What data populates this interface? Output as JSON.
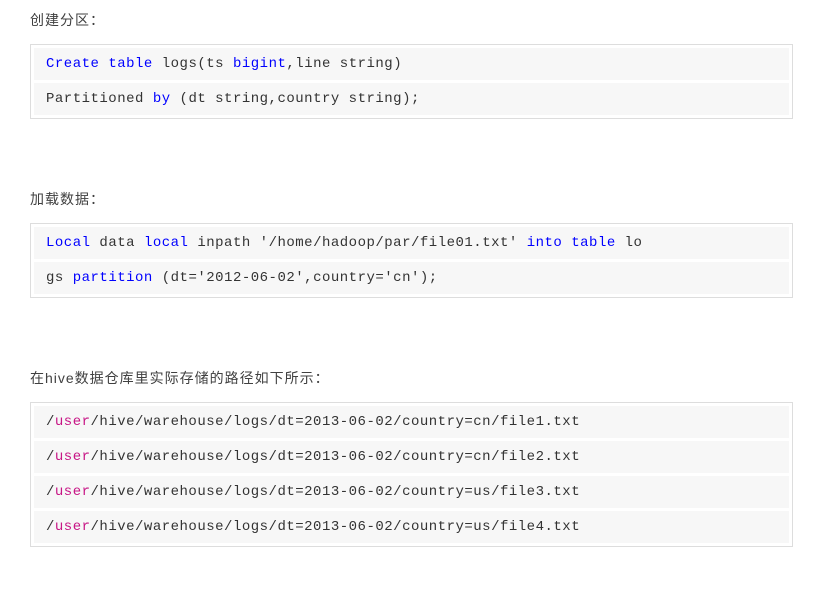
{
  "sections": {
    "s1": {
      "title": "创建分区：",
      "code": {
        "line1": {
          "t1": "Create",
          "t2": " ",
          "t3": "table",
          "t4": " logs(ts ",
          "t5": "bigint",
          "t6": ",line string)"
        },
        "line2": {
          "t1": "Partitioned ",
          "t2": "by",
          "t3": " (dt string,country string);"
        }
      }
    },
    "s2": {
      "title": "加载数据：",
      "code": {
        "line1": {
          "t1": "Local",
          "t2": " data ",
          "t3": "local",
          "t4": " inpath '/home/hadoop/par/file01.txt' ",
          "t5": "into",
          "t6": " ",
          "t7": "table",
          "t8": " lo"
        },
        "line2": {
          "t1": "gs ",
          "t2": "partition",
          "t3": " (dt='2012-06-02',country='cn');"
        }
      }
    },
    "s3": {
      "title": "在hive数据仓库里实际存储的路径如下所示：",
      "code": {
        "line1": {
          "t1": "/",
          "t2": "user",
          "t3": "/hive/warehouse/logs/dt=2013-06-02/country=cn/file1.txt"
        },
        "line2": {
          "t1": "/",
          "t2": "user",
          "t3": "/hive/warehouse/logs/dt=2013-06-02/country=cn/file2.txt"
        },
        "line3": {
          "t1": "/",
          "t2": "user",
          "t3": "/hive/warehouse/logs/dt=2013-06-02/country=us/file3.txt"
        },
        "line4": {
          "t1": "/",
          "t2": "user",
          "t3": "/hive/warehouse/logs/dt=2013-06-02/country=us/file4.txt"
        }
      }
    }
  }
}
